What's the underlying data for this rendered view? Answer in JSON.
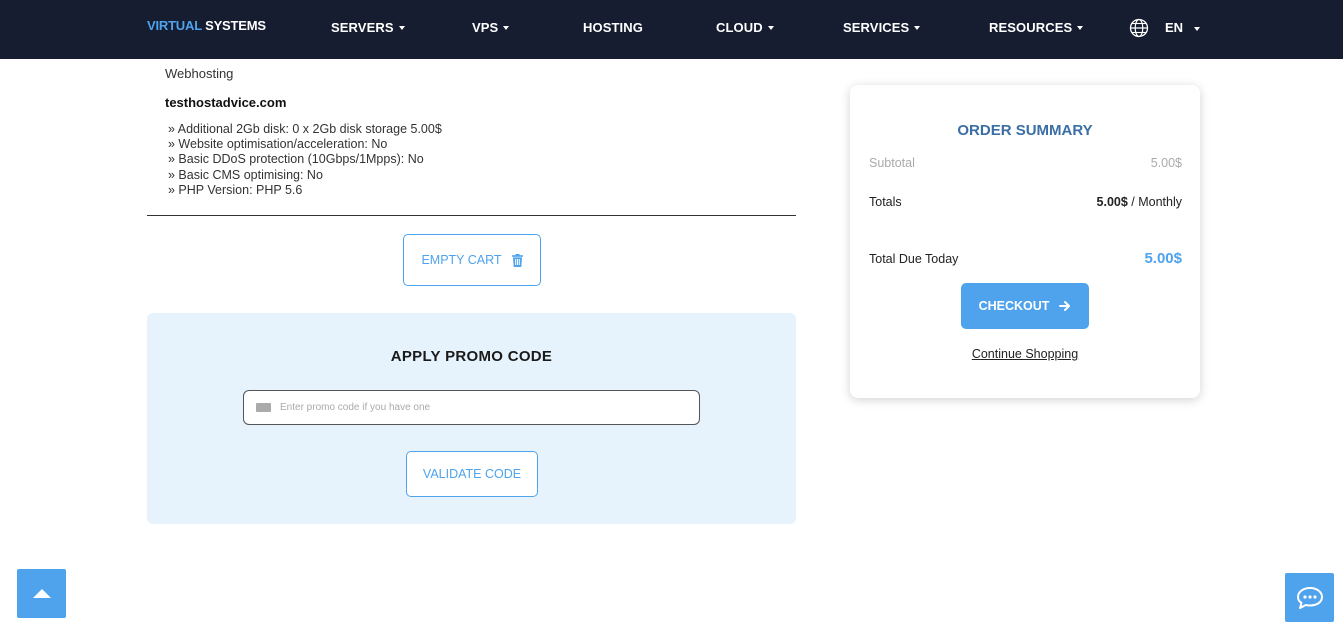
{
  "nav": {
    "logo_part1": "VIRTUAL",
    "logo_part2": " SYSTEMS",
    "items": [
      {
        "label": "SERVERS"
      },
      {
        "label": "VPS"
      },
      {
        "label": "HOSTING"
      },
      {
        "label": "CLOUD"
      },
      {
        "label": "SERVICES"
      },
      {
        "label": "RESOURCES"
      }
    ],
    "language": "EN"
  },
  "cart_item": {
    "product_group": "Webhosting",
    "domain": "testhostadvice.com",
    "options": [
      "» Additional 2Gb disk: 0 x 2Gb disk storage 5.00$",
      "» Website optimisation/acceleration: No",
      "» Basic DDoS protection (10Gbps/1Mpps): No",
      "» Basic CMS optimising: No",
      "» PHP Version: PHP 5.6"
    ]
  },
  "empty_cart_label": "EMPTY CART",
  "promo": {
    "title": "APPLY PROMO CODE",
    "placeholder": "Enter promo code if you have one",
    "validate_label": "VALIDATE CODE"
  },
  "summary": {
    "title": "ORDER SUMMARY",
    "subtotal_label": "Subtotal",
    "subtotal_value": "5.00$",
    "totals_label": "Totals",
    "totals_amount": "5.00$",
    "totals_period": " / Monthly",
    "due_label": "Total Due Today",
    "due_value": "5.00$",
    "checkout_label": "CHECKOUT",
    "continue_label": "Continue Shopping"
  },
  "colors": {
    "accent": "#4fa3ec",
    "nav_bg": "#161d30",
    "promo_bg": "#e6f3fc",
    "summary_title": "#3a6ea5"
  },
  "icons": [
    "globe-icon",
    "trash-icon",
    "ticket-icon",
    "arrow-right-icon",
    "arrow-up-icon",
    "chat-icon"
  ]
}
